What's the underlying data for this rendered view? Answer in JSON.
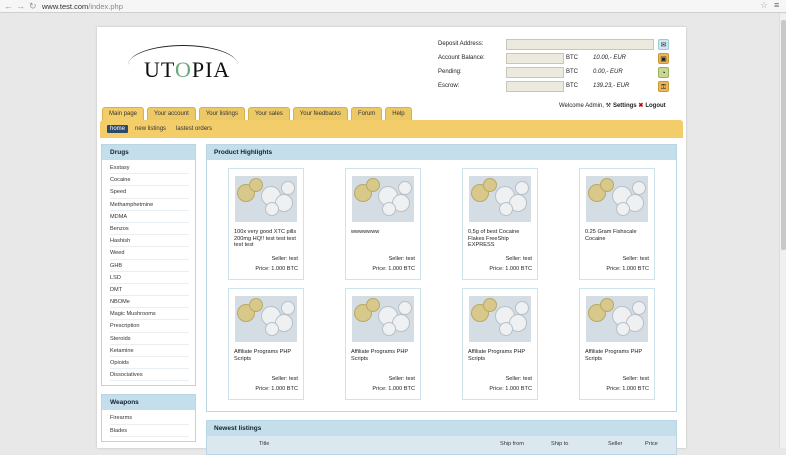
{
  "browser": {
    "back": "←",
    "forward": "→",
    "reload": "↻",
    "url_domain": "www.test.com",
    "url_path": "/index.php",
    "star": "☆",
    "menu": "≡"
  },
  "logo": {
    "text_a": "UT",
    "text_o": "O",
    "text_b": "PIA"
  },
  "account": {
    "deposit_label": "Deposit Address:",
    "balance_label": "Account Balance:",
    "balance_unit": "BTC",
    "balance_value": "10.00,- EUR",
    "pending_label": "Pending:",
    "pending_unit": "BTC",
    "pending_value": "0.00,- EUR",
    "escrow_label": "Escrow:",
    "escrow_unit": "BTC",
    "escrow_value": "139.23,- EUR"
  },
  "user": {
    "welcome": "Welcome Admin,",
    "settings": "Settings",
    "logout": "Logout"
  },
  "nav": {
    "tabs": [
      "Main page",
      "Your account",
      "Your listings",
      "Your sales",
      "Your feedbacks",
      "Forum",
      "Help"
    ],
    "sub": [
      "home",
      "new listings",
      "lastest orders"
    ]
  },
  "sidebar": {
    "drugs_title": "Drugs",
    "drugs": [
      "Exstasy",
      "Cocaine",
      "Speed",
      "Methamphetmine",
      "MDMA",
      "Benzos",
      "Hashish",
      "Weed",
      "GHB",
      "LSD",
      "DMT",
      "NBOMe",
      "Magic Mushrooms",
      "Prescription",
      "Steroids",
      "Ketamine",
      "Opioids",
      "Dissociatives"
    ],
    "weapons_title": "Weapons",
    "weapons": [
      "Firearms",
      "Blades"
    ]
  },
  "highlights": {
    "title": "Product Highlights",
    "products": [
      {
        "title": "100x very good XTC pills 200mg HQ!! test test test test test",
        "seller": "Seller: test",
        "price": "Price: 1.000 BTC"
      },
      {
        "title": "wwwwwww",
        "seller": "Seller: test",
        "price": "Price: 1.000 BTC"
      },
      {
        "title": "0,5g of best Cocaine Flakes FreeShip EXPRESS",
        "seller": "Seller: test",
        "price": "Price: 1.000 BTC"
      },
      {
        "title": "0.25 Gram Fishscale Cocaine",
        "seller": "Seller: test",
        "price": "Price: 1.000 BTC"
      },
      {
        "title": "Affiliate Programs PHP Scripts",
        "seller": "Seller: test",
        "price": "Price: 1.000 BTC"
      },
      {
        "title": "Affiliate Programs PHP Scripts",
        "seller": "Seller: test",
        "price": "Price: 1.000 BTC"
      },
      {
        "title": "Affiliate Programs PHP Scripts",
        "seller": "Seller: test",
        "price": "Price: 1.000 BTC"
      },
      {
        "title": "Affiliate Programs PHP Scripts",
        "seller": "Seller: test",
        "price": "Price: 1.000 BTC"
      }
    ]
  },
  "newest": {
    "title": "Newest listings",
    "columns": [
      "Title",
      "Ship from",
      "Ship to",
      "Seller",
      "Price"
    ]
  }
}
